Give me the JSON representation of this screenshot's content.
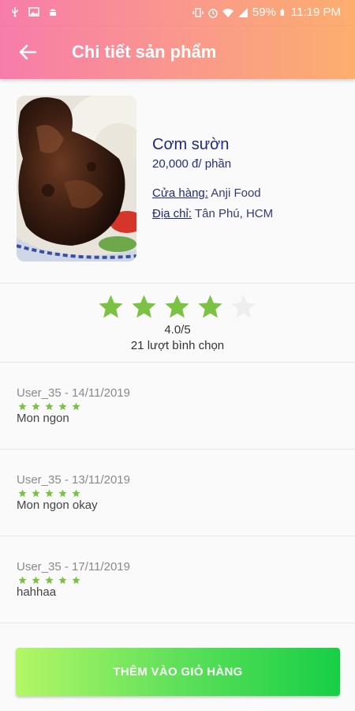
{
  "status_bar": {
    "battery": "59%",
    "time": "11:19 PM"
  },
  "appbar": {
    "title": "Chi tiết sản phẩm",
    "back_icon": "arrow-left-icon"
  },
  "product": {
    "name": "Cơm sườn",
    "price": "20,000 đ/ phần",
    "store_label": "Cửa hàng:",
    "store_value": "Anji Food",
    "address_label": "Địa chỉ:",
    "address_value": "Tân Phú, HCM"
  },
  "rating": {
    "value": 4,
    "max": 5,
    "score_text": "4.0/5",
    "count_text": "21 lượt bình chọn"
  },
  "reviews": [
    {
      "user": "User_35 - 14/11/2019",
      "stars": 5,
      "comment": "Mon ngon"
    },
    {
      "user": "User_35 - 13/11/2019",
      "stars": 5,
      "comment": "Mon ngon okay"
    },
    {
      "user": "User_35 - 17/11/2019",
      "stars": 5,
      "comment": "hahhaa"
    }
  ],
  "cart_button": {
    "label": "THÊM VÀO GIỎ HÀNG"
  },
  "colors": {
    "header_start": "#f77cab",
    "header_end": "#fcae6e",
    "star_filled": "#7cc242",
    "star_empty": "#eeeeee",
    "button_start": "#b3f766",
    "button_end": "#16cf45"
  }
}
